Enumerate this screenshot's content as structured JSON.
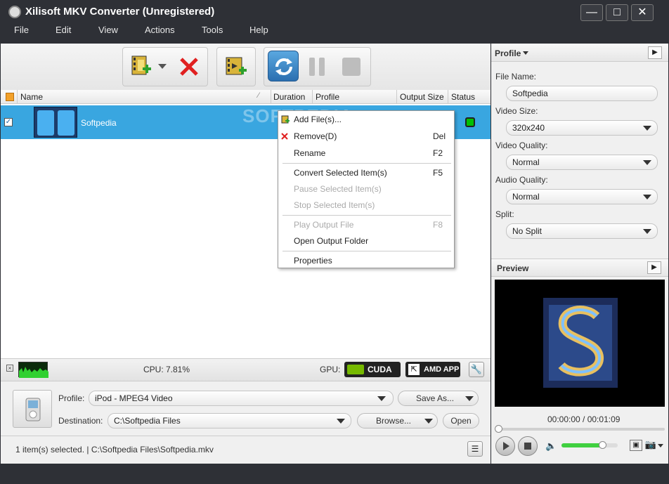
{
  "window": {
    "title": "Xilisoft MKV Converter (Unregistered)"
  },
  "menu": [
    "File",
    "Edit",
    "View",
    "Actions",
    "Tools",
    "Help"
  ],
  "columns": {
    "name": "Name",
    "duration": "Duration",
    "profile": "Profile",
    "output_size": "Output Size",
    "status": "Status"
  },
  "file": {
    "name": "Softpedia"
  },
  "context_menu": [
    {
      "label": "Add File(s)...",
      "key": "",
      "enabled": true
    },
    {
      "label": "Remove(D)",
      "key": "Del",
      "enabled": true
    },
    {
      "label": "Rename",
      "key": "F2",
      "enabled": true
    },
    {
      "label": "Convert Selected Item(s)",
      "key": "F5",
      "enabled": true
    },
    {
      "label": "Pause Selected Item(s)",
      "key": "",
      "enabled": false
    },
    {
      "label": "Stop Selected Item(s)",
      "key": "",
      "enabled": false
    },
    {
      "label": "Play Output File",
      "key": "F8",
      "enabled": false
    },
    {
      "label": "Open Output Folder",
      "key": "",
      "enabled": true
    },
    {
      "label": "Properties",
      "key": "",
      "enabled": true
    }
  ],
  "strip": {
    "cpu": "CPU: 7.81%",
    "gpu": "GPU:",
    "cuda": "CUDA",
    "amd": "AMD APP"
  },
  "bottom": {
    "profile_label": "Profile:",
    "profile_value": "iPod - MPEG4 Video",
    "save_as": "Save As...",
    "dest_label": "Destination:",
    "dest_value": "C:\\Softpedia Files",
    "browse": "Browse...",
    "open": "Open"
  },
  "status": {
    "text": "1 item(s) selected. | C:\\Softpedia Files\\Softpedia.mkv"
  },
  "profile_panel": {
    "header": "Profile",
    "file_name_label": "File Name:",
    "file_name": "Softpedia",
    "video_size_label": "Video Size:",
    "video_size": "320x240",
    "video_quality_label": "Video Quality:",
    "video_quality": "Normal",
    "audio_quality_label": "Audio Quality:",
    "audio_quality": "Normal",
    "split_label": "Split:",
    "split": "No Split"
  },
  "preview": {
    "header": "Preview",
    "time": "00:00:00 / 00:01:09",
    "volume": 0.72
  },
  "watermark": "SOFTPEDIA",
  "colors": {
    "chrome": "#2e3036",
    "selection": "#39a6e0",
    "status_green": "#00c000",
    "remove_red": "#e02020"
  }
}
